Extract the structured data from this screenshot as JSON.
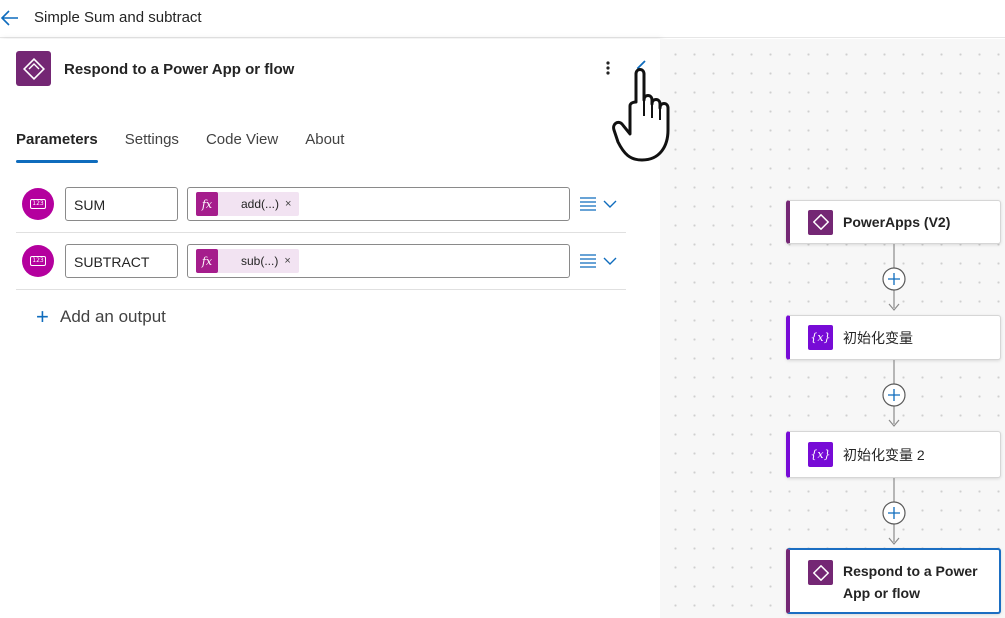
{
  "header": {
    "title": "Simple Sum and subtract"
  },
  "panel": {
    "action_title": "Respond to a Power App or flow",
    "tabs": [
      {
        "label": "Parameters",
        "active": true
      },
      {
        "label": "Settings",
        "active": false
      },
      {
        "label": "Code View",
        "active": false
      },
      {
        "label": "About",
        "active": false
      }
    ],
    "outputs": [
      {
        "type_icon": "number-type-icon",
        "name": "SUM",
        "token": "add(...)"
      },
      {
        "type_icon": "number-type-icon",
        "name": "SUBTRACT",
        "token": "sub(...)"
      }
    ],
    "add_output_label": "Add an output",
    "token_remove": "×",
    "fx_label": "fx",
    "type_icon_text": "123"
  },
  "canvas": {
    "nodes": [
      {
        "label": "PowerApps (V2)",
        "kind": "powerapps"
      },
      {
        "label": "初始化变量",
        "kind": "variable"
      },
      {
        "label": "初始化变量 2",
        "kind": "variable"
      },
      {
        "label": "Respond to a Power App or flow",
        "kind": "powerapps",
        "selected": true
      }
    ],
    "var_icon_text": "{x}"
  },
  "colors": {
    "powerapps_purple": "#742774",
    "variable_purple": "#770bd6",
    "fx_magenta": "#a51d8c",
    "accent_blue": "#0f6cbd"
  }
}
